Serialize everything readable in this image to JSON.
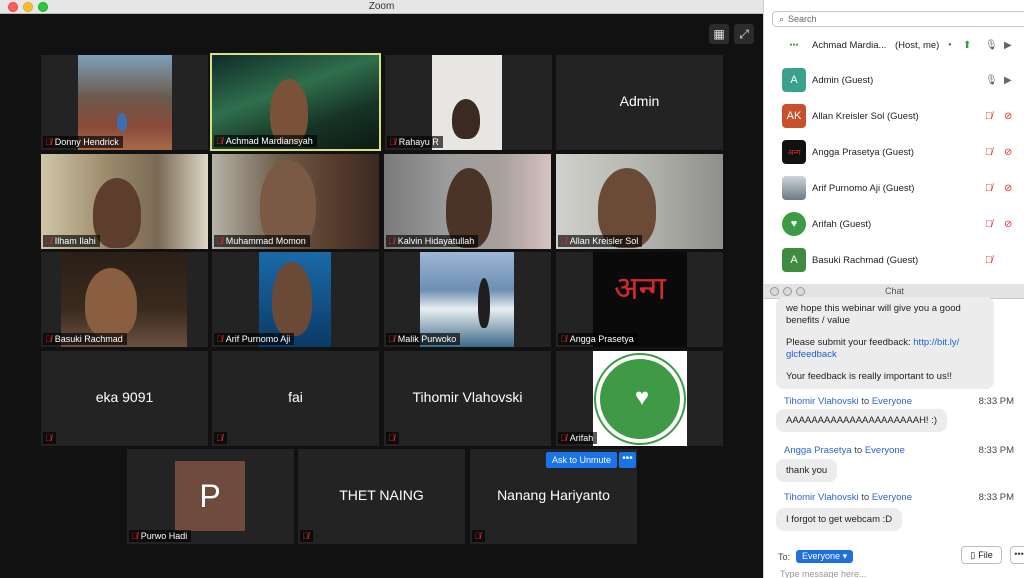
{
  "window": {
    "title": "Zoom"
  },
  "gallery": {
    "tiles": [
      {
        "name": "Donny Hendrick"
      },
      {
        "name": "Achmad Mardiansyah"
      },
      {
        "name": "Rahayu R"
      },
      {
        "name": "Admin",
        "center": "Admin"
      },
      {
        "name": "Ilham Ilahi"
      },
      {
        "name": "Muhammad Momon"
      },
      {
        "name": "Kalvin Hidayatullah"
      },
      {
        "name": "Allan Kreisler Sol"
      },
      {
        "name": "Basuki Rachmad"
      },
      {
        "name": "Arif Purnomo Aji"
      },
      {
        "name": "Malik Purwoko"
      },
      {
        "name": "Angga Prasetya",
        "logo_text": "अन्ग"
      },
      {
        "name": "",
        "center": "eka 9091"
      },
      {
        "name": "",
        "center": "fai"
      },
      {
        "name": "",
        "center": "Tihomir Vlahovski"
      },
      {
        "name": "Arifah"
      },
      {
        "name": "Purwo Hadi",
        "avatar_letter": "P"
      },
      {
        "name": "",
        "center": "THET NAING"
      },
      {
        "name": "",
        "center": "Nanang Hariyanto"
      }
    ],
    "ask_to_unmute": "Ask to Unmute",
    "more": "•••"
  },
  "participants": {
    "search_placeholder": "Search",
    "list": [
      {
        "avatar": "",
        "name": "Achmad Mardia...",
        "role": "(Host, me)",
        "color": "#ffffff"
      },
      {
        "avatar": "A",
        "name": "Admin (Guest)",
        "color": "#3aa18c"
      },
      {
        "avatar": "AK",
        "name": "Allan Kreisler Sol (Guest)",
        "color": "#c8502c"
      },
      {
        "avatar": "अन्ग",
        "name": "Angga Prasetya (Guest)",
        "color": "#111111"
      },
      {
        "avatar": "",
        "name": "Arif Purnomo Aji (Guest)",
        "color": "#8a9aa4"
      },
      {
        "avatar": "",
        "name": "Arifah (Guest)",
        "color": "#3e9a45"
      },
      {
        "avatar": "A",
        "name": "Basuki Rachmad (Guest)",
        "color": "#3f8b3f"
      }
    ]
  },
  "chat": {
    "title": "Chat",
    "first_bubble_line1": "we hope this webinar will give you a good",
    "first_bubble_line2": "benefits / value",
    "first_bubble_line3": "Please submit your feedback: ",
    "first_bubble_link1": "http://bit.ly/",
    "first_bubble_link2": "glcfeedback",
    "first_bubble_line4": "Your feedback is really important to us!!",
    "messages": [
      {
        "sender": "Tihomir Vlahovski",
        "to": "to",
        "target": "Everyone",
        "time": "8:33 PM",
        "text": "AAAAAAAAAAAAAAAAAAAAAH! :)"
      },
      {
        "sender": "Angga Prasetya",
        "to": "to",
        "target": "Everyone",
        "time": "8:33 PM",
        "text": "thank you"
      },
      {
        "sender": "Tihomir Vlahovski",
        "to": "to",
        "target": "Everyone",
        "time": "8:33 PM",
        "text": "I forgot to get webcam :D"
      }
    ],
    "to_label": "To:",
    "to_value": "Everyone",
    "file_label": "File",
    "input_placeholder": "Type message here..."
  }
}
